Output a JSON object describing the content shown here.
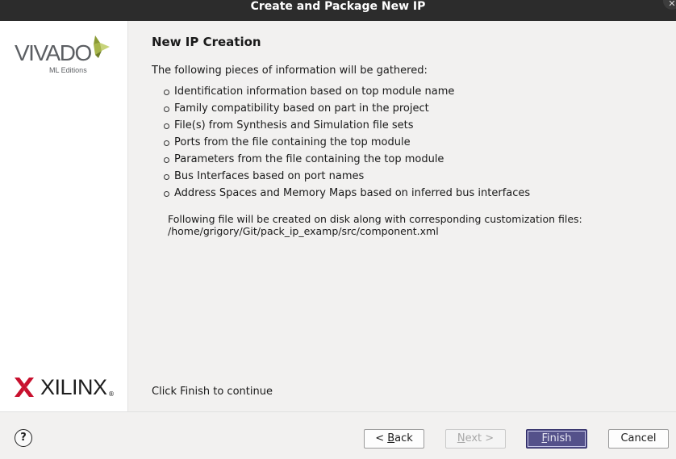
{
  "window": {
    "title": "Create and Package New IP",
    "close_glyph": "✕"
  },
  "sidebar": {
    "vivado_logo": {
      "word": "VIVADO",
      "sub": "ML Editions"
    },
    "xilinx_logo": {
      "word": "XILINX",
      "reg": "®"
    }
  },
  "main": {
    "heading": "New IP Creation",
    "intro": "The following pieces of information will be gathered:",
    "bullets": [
      "Identification information based on top module name",
      "Family compatibility based on part in the project",
      "File(s) from Synthesis and Simulation file sets",
      "Ports from the file containing the top module",
      "Parameters from the file containing the top module",
      "Bus Interfaces based on port names",
      "Address Spaces and Memory Maps based on inferred bus interfaces"
    ],
    "file_note_line1": "Following file will be created on disk along with corresponding customization files:",
    "file_note_line2": "/home/grigory/Git/pack_ip_examp/src/component.xml",
    "continue_text": "Click Finish to continue"
  },
  "footer": {
    "help_label": "?",
    "back": {
      "pre": "< ",
      "mnemonic": "B",
      "rest": "ack"
    },
    "next": {
      "mnemonic": "N",
      "rest": "ext >"
    },
    "finish": {
      "mnemonic": "F",
      "rest": "inish"
    },
    "cancel": "Cancel"
  },
  "colors": {
    "titlebar": "#2c2c2c",
    "finish_button": "#54518a",
    "xilinx_red": "#c8102e",
    "vivado_green": "#8a9a34"
  }
}
